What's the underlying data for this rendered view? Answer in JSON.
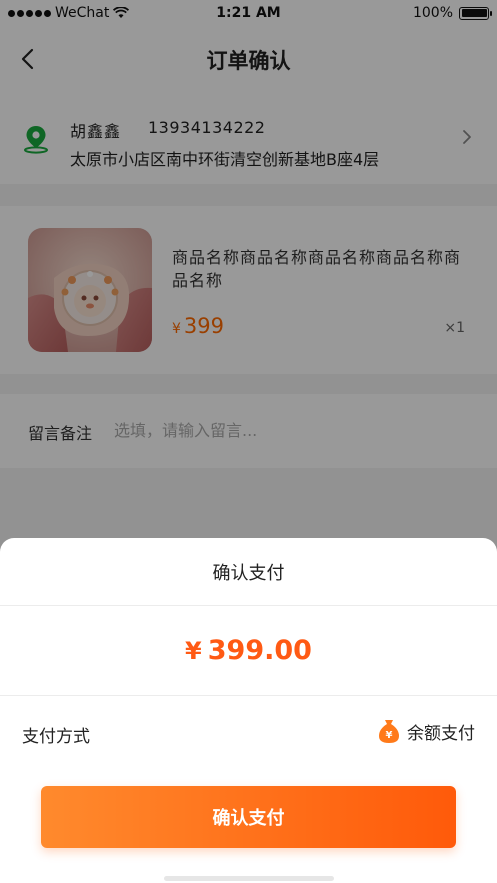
{
  "status_bar": {
    "carrier": "WeChat",
    "time": "1:21 AM",
    "battery": "100%"
  },
  "nav": {
    "title": "订单确认"
  },
  "address": {
    "name": "胡鑫鑫",
    "phone": "13934134222",
    "detail": "太原市小店区南中环街清空创新基地B座4层"
  },
  "product": {
    "name": "商品名称商品名称商品名称商品名称商品名称",
    "currency": "¥",
    "price": "399",
    "quantity": "×1"
  },
  "remark": {
    "label": "留言备注",
    "placeholder": "选填，请输入留言..."
  },
  "payment_sheet": {
    "title": "确认支付",
    "currency": "¥",
    "amount": "399.00",
    "method_label": "支付方式",
    "method_value": "余额支付",
    "confirm_label": "确认支付"
  },
  "colors": {
    "accent": "#ff5a14",
    "location_icon": "#1aab3f"
  },
  "icons": {
    "back": "chevron-left-icon",
    "location": "location-pin-icon",
    "arrow": "chevron-right-icon",
    "wallet": "money-bag-icon"
  }
}
